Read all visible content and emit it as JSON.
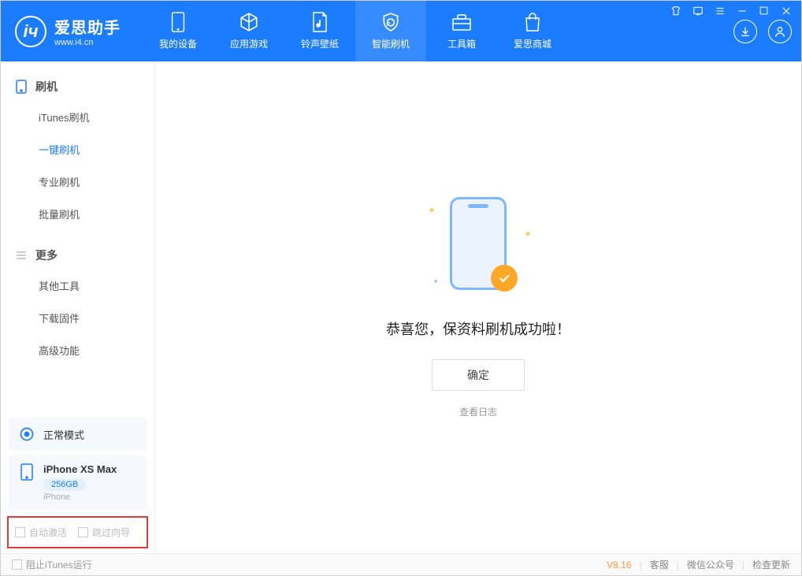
{
  "app": {
    "title": "爱思助手",
    "subtitle": "www.i4.cn"
  },
  "nav": {
    "items": [
      {
        "label": "我的设备"
      },
      {
        "label": "应用游戏"
      },
      {
        "label": "铃声壁纸"
      },
      {
        "label": "智能刷机"
      },
      {
        "label": "工具箱"
      },
      {
        "label": "爱思商城"
      }
    ]
  },
  "sidebar": {
    "sections": [
      {
        "title": "刷机",
        "items": [
          "iTunes刷机",
          "一键刷机",
          "专业刷机",
          "批量刷机"
        ]
      },
      {
        "title": "更多",
        "items": [
          "其他工具",
          "下载固件",
          "高级功能"
        ]
      }
    ],
    "mode": "正常模式",
    "device": {
      "name": "iPhone XS Max",
      "storage": "256GB",
      "type": "iPhone"
    },
    "options": {
      "auto_activate": "自动激活",
      "skip_guide": "跳过向导"
    }
  },
  "main": {
    "success_msg": "恭喜您，保资料刷机成功啦！",
    "ok_button": "确定",
    "log_link": "查看日志"
  },
  "footer": {
    "block_itunes": "阻止iTunes运行",
    "version": "V8.16",
    "links": [
      "客服",
      "微信公众号",
      "检查更新"
    ]
  }
}
